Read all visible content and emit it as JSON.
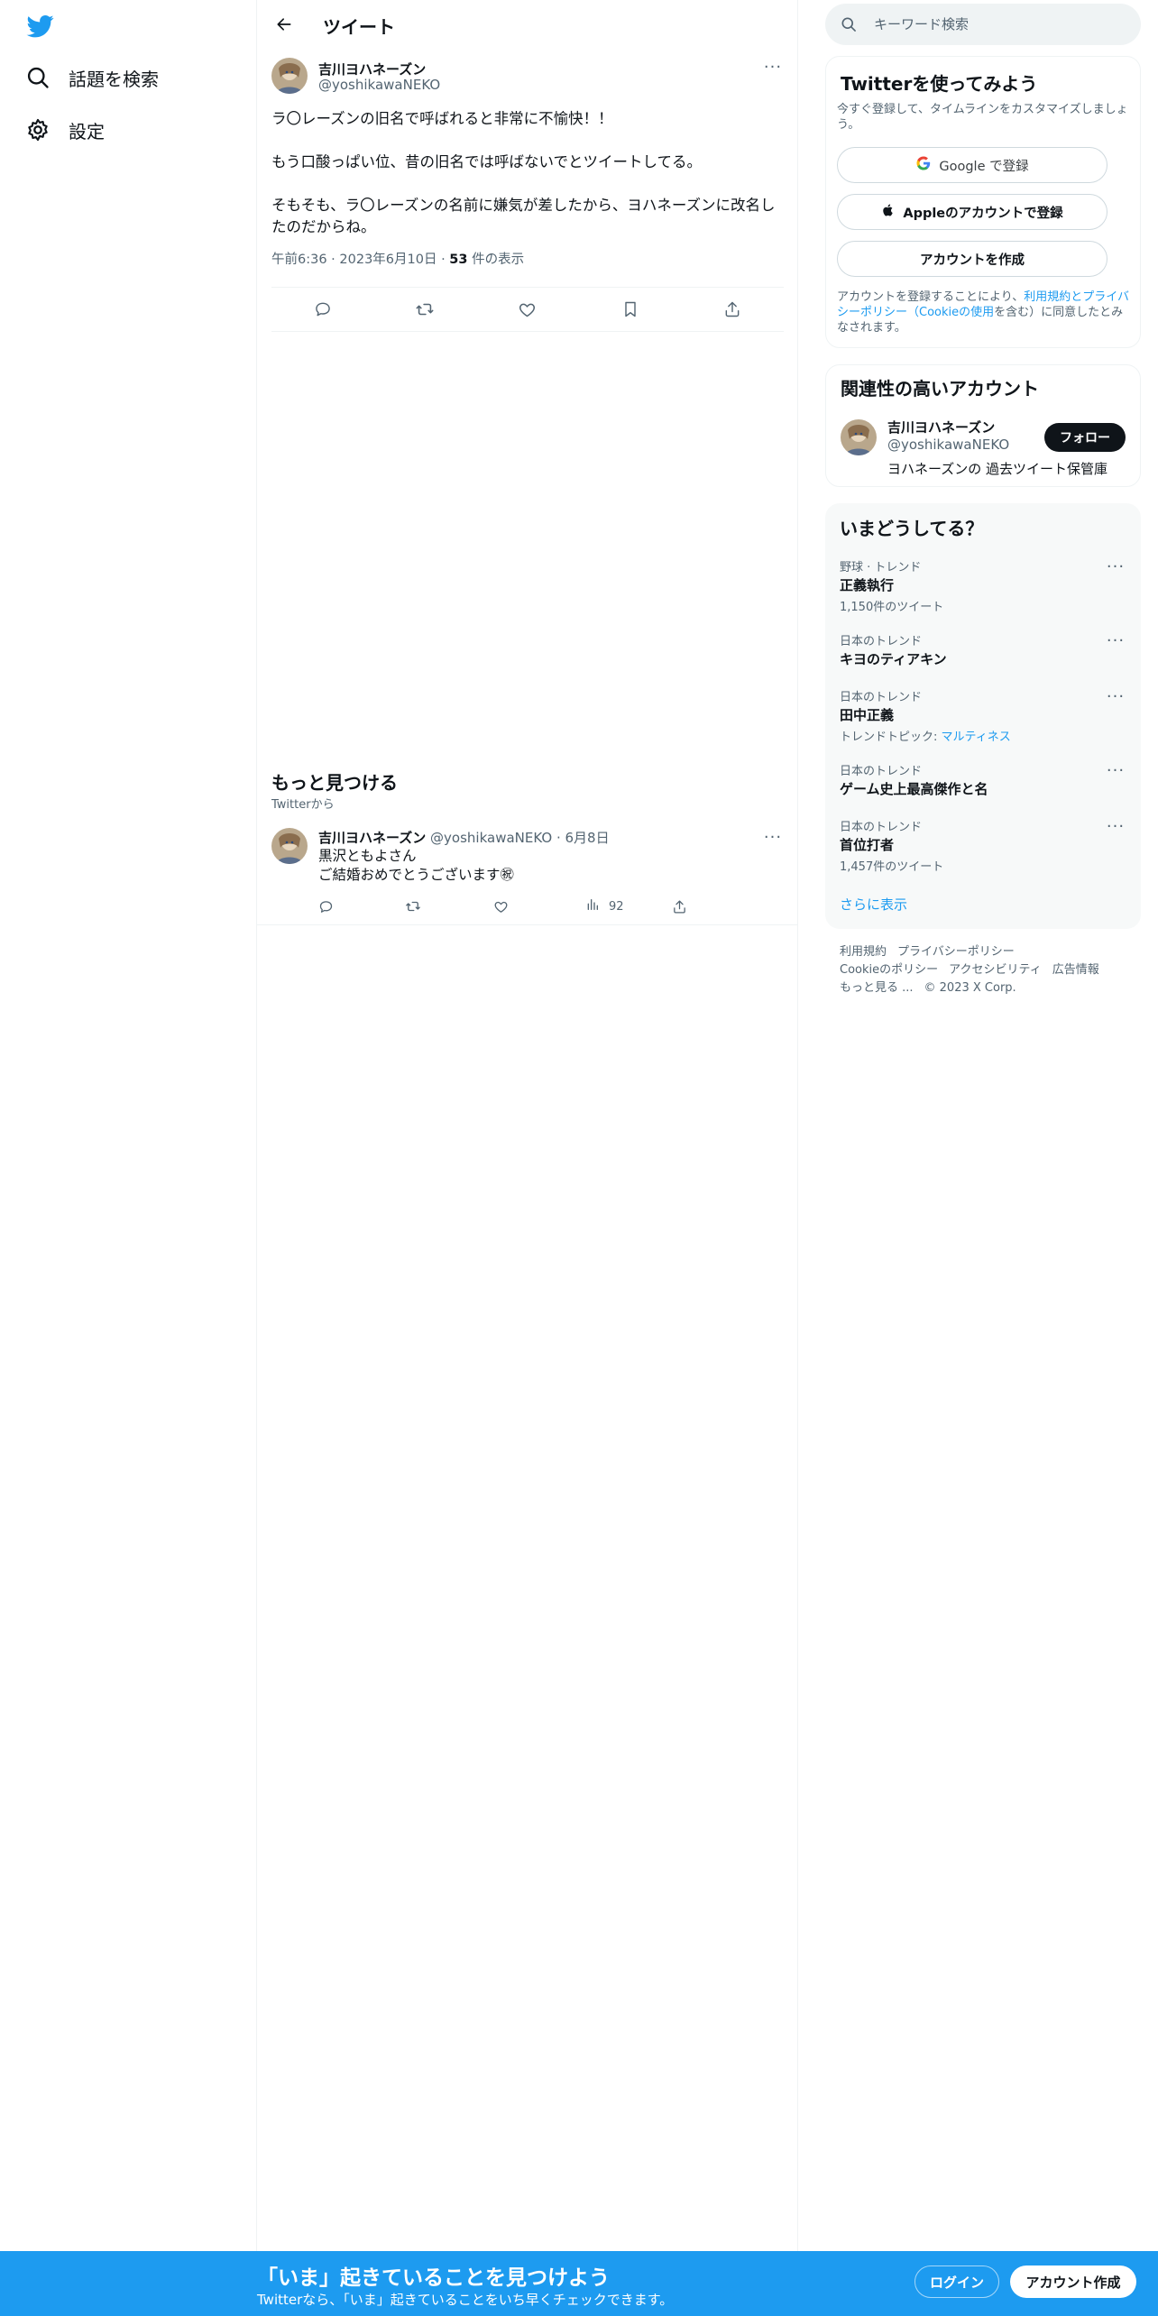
{
  "nav": {
    "logo": "twitter-bird-icon",
    "items": [
      {
        "label": "話題を検索",
        "icon": "search-icon"
      },
      {
        "label": "設定",
        "icon": "gear-icon"
      }
    ]
  },
  "header": {
    "title": "ツイート"
  },
  "tweet": {
    "name": "吉川ヨハネーズン",
    "handle": "@yoshikawaNEKO",
    "paragraphs": [
      "ラ〇レーズンの旧名で呼ばれると非常に不愉快！！",
      "もう口酸っぱい位、昔の旧名では呼ばないでとツイートしてる。",
      "そもそも、ラ〇レーズンの名前に嫌気が差したから、ヨハネーズンに改名したのだからね。"
    ],
    "time": "午前6:36",
    "date": "2023年6月10日",
    "views": "53",
    "views_suffix": "件の表示"
  },
  "discover": {
    "title": "もっと見つける",
    "sub": "Twitterから",
    "tweet": {
      "name": "吉川ヨハネーズン",
      "handle": "@yoshikawaNEKO",
      "date": "6月8日",
      "line1": "黒沢ともよさん",
      "line2": "ご結婚おめでとうございます㊗",
      "views": "92"
    }
  },
  "search": {
    "placeholder": "キーワード検索"
  },
  "signup": {
    "title": "Twitterを使ってみよう",
    "sub": "今すぐ登録して、タイムラインをカスタマイズしましょう。",
    "google": "Google で登録",
    "apple": "Appleのアカウントで登録",
    "create": "アカウントを作成",
    "legal_pre": "アカウントを登録することにより、",
    "legal_terms": "利用規約",
    "legal_and": "と",
    "legal_privacy": "プライバシーポリシー（Cookieの使用",
    "legal_post": "を含む）に同意したとみなされます。"
  },
  "related": {
    "title": "関連性の高いアカウント",
    "name": "吉川ヨハネーズン",
    "handle": "@yoshikawaNEKO",
    "bio": "ヨハネーズンの 過去ツイート保管庫",
    "follow": "フォロー"
  },
  "trends": {
    "title": "いまどうしてる？",
    "items": [
      {
        "cat": "野球 · トレンド",
        "name": "正義執行",
        "cnt": "1,150件のツイート"
      },
      {
        "cat": "日本のトレンド",
        "name": "キヨのティアキン",
        "cnt": ""
      },
      {
        "cat": "日本のトレンド",
        "name": "田中正義",
        "cnt": "トレンドトピック: ",
        "topic": "マルティネス"
      },
      {
        "cat": "日本のトレンド",
        "name": "ゲーム史上最高傑作と名",
        "cnt": ""
      },
      {
        "cat": "日本のトレンド",
        "name": "首位打者",
        "cnt": "1,457件のツイート"
      }
    ],
    "show_more": "さらに表示"
  },
  "footer": {
    "links": [
      "利用規約",
      "プライバシーポリシー",
      "Cookieのポリシー",
      "アクセシビリティ",
      "広告情報",
      "もっと見る ...",
      "© 2023 X Corp."
    ]
  },
  "bottombar": {
    "title": "「いま」起きていることを見つけよう",
    "sub": "Twitterなら、「いま」起きていることをいち早くチェックできます。",
    "login": "ログイン",
    "signup": "アカウント作成"
  },
  "colors": {
    "accent": "#1d9bf0",
    "text": "#0f1419",
    "muted": "#536471",
    "border": "#eff3f4"
  }
}
